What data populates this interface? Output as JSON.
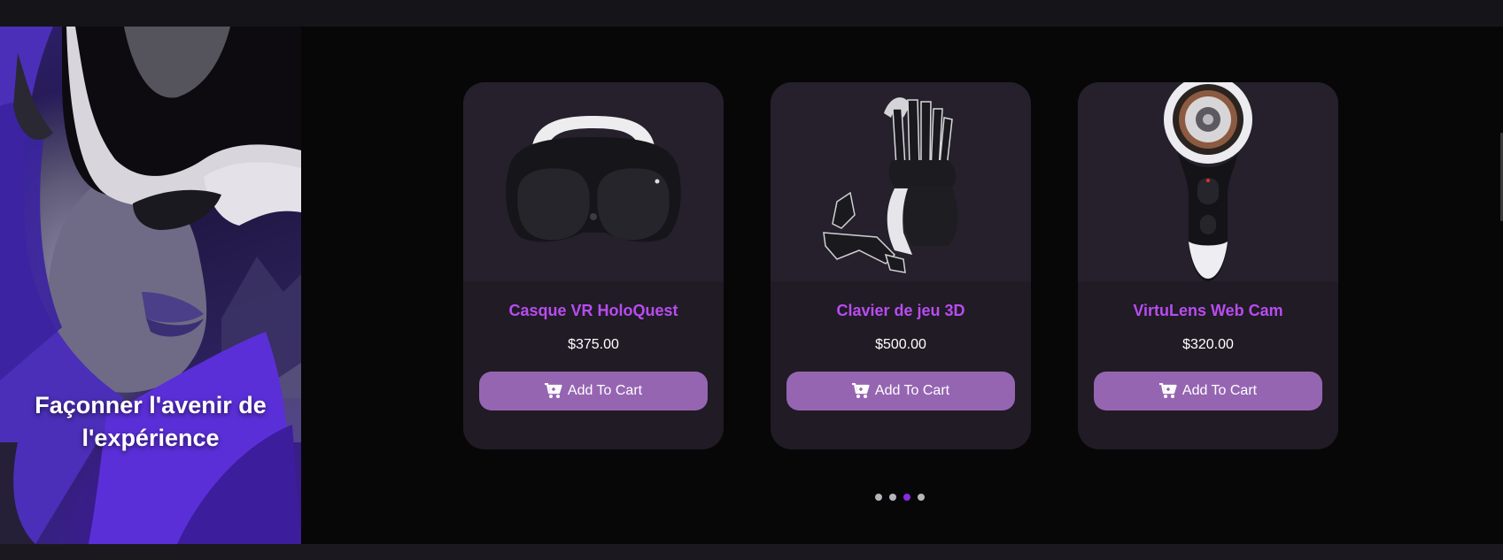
{
  "hero": {
    "title_line1": "Façonner l'avenir de",
    "title_line2": "l'expérience",
    "image_icon": "vr-headset-portrait"
  },
  "products": [
    {
      "name": "Casque VR HoloQuest",
      "price": "$375.00",
      "button_label": "Add To Cart",
      "image_icon": "vr-headset-icon"
    },
    {
      "name": "Clavier de jeu 3D",
      "price": "$500.00",
      "button_label": "Add To Cart",
      "image_icon": "haptic-glove-icon"
    },
    {
      "name": "VirtuLens Web Cam",
      "price": "$320.00",
      "button_label": "Add To Cart",
      "image_icon": "360-camera-icon"
    }
  ],
  "carousel": {
    "dot_count": 4,
    "active_index": 2
  },
  "colors": {
    "accent": "#b84cf0",
    "button": "#9565b2",
    "card_bg": "#201b25",
    "page_bg": "#080708",
    "dot_active": "#8a2be2"
  }
}
